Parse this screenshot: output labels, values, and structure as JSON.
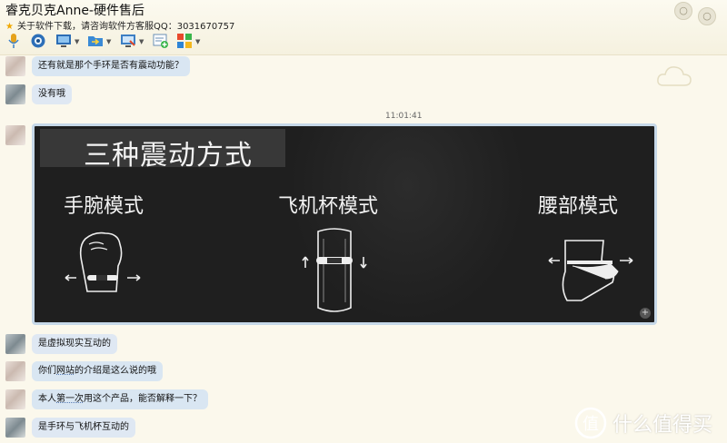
{
  "window": {
    "title": "睿克贝克Anne-硬件售后",
    "signature": "关于软件下载，请咨询软件方客服QQ：3031670757"
  },
  "toolbar": {
    "items": [
      {
        "icon": "microphone-icon"
      },
      {
        "icon": "camera-icon"
      },
      {
        "icon": "screen-share-icon"
      },
      {
        "icon": "file-transfer-icon"
      },
      {
        "icon": "remote-desktop-icon"
      },
      {
        "icon": "add-app-icon"
      },
      {
        "icon": "apps-grid-icon"
      }
    ]
  },
  "messages": [
    {
      "side": "customer",
      "text": "还有就是那个手环是否有震动功能？"
    },
    {
      "side": "agent",
      "text": "没有哦"
    },
    {
      "side": "agent",
      "text_pre": "",
      "timestamp": "11:01:41"
    },
    {
      "side": "agent",
      "text": "是虚拟现实互动的"
    },
    {
      "side": "customer",
      "text_pre": "你们",
      "text_u": "网站",
      "text_post": "的介绍是这么说的哦"
    },
    {
      "side": "customer",
      "text_pre": "本人",
      "text_u": "第一次",
      "text_post": "用这个产品，能否解释一下？"
    },
    {
      "side": "agent",
      "text": "是手环与飞机杯互动的"
    }
  ],
  "image": {
    "banner": "三种震动方式",
    "modes": [
      "手腕模式",
      "飞机杯模式",
      "腰部模式"
    ]
  },
  "watermark": {
    "text": "什么值得买",
    "logo": "值"
  }
}
